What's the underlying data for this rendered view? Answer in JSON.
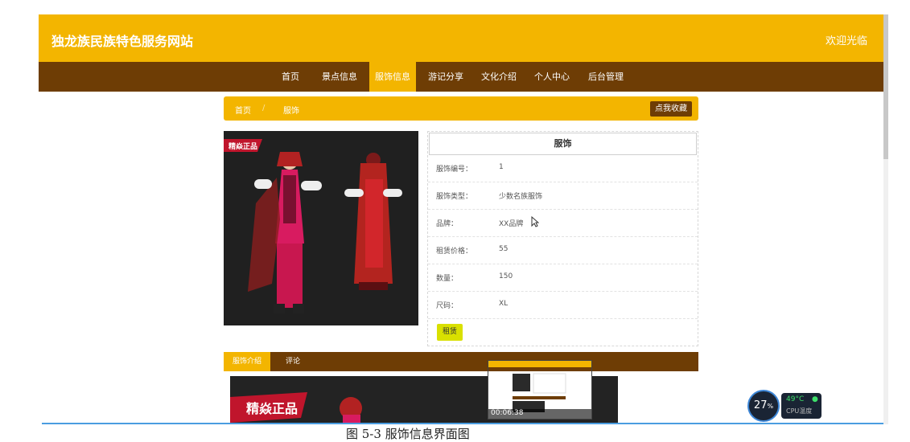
{
  "header": {
    "site_title": "独龙族民族特色服务网站",
    "welcome": "欢迎光临"
  },
  "nav": [
    {
      "label": "首页",
      "active": false
    },
    {
      "label": "景点信息",
      "active": false
    },
    {
      "label": "服饰信息",
      "active": true
    },
    {
      "label": "游记分享",
      "active": false
    },
    {
      "label": "文化介绍",
      "active": false
    },
    {
      "label": "个人中心",
      "active": false
    },
    {
      "label": "后台管理",
      "active": false
    }
  ],
  "breadcrumb": {
    "home": "首页",
    "separator": "/",
    "current": "服饰",
    "favorite_button": "点我收藏"
  },
  "product": {
    "image_badge": "精焱正品",
    "title": "服饰",
    "fields": [
      {
        "label": "服饰编号：",
        "value": "1"
      },
      {
        "label": "服饰类型：",
        "value": "少数名族服饰"
      },
      {
        "label": "品牌：",
        "value": "XX品牌"
      },
      {
        "label": "租赁价格：",
        "value": "55"
      },
      {
        "label": "数量：",
        "value": "150"
      },
      {
        "label": "尺码：",
        "value": "XL"
      }
    ],
    "rent_button": "租赁"
  },
  "tabs": [
    {
      "label": "服饰介绍",
      "active": true
    },
    {
      "label": "评论",
      "active": false
    }
  ],
  "intro_image_text": "精焱正品",
  "video_preview": {
    "time": "00:06:38"
  },
  "cpu_widget": {
    "percent": "27",
    "percent_unit": "%",
    "temp": "49°C",
    "label": "CPU温度"
  },
  "caption": "图 5-3 服饰信息界面图",
  "colors": {
    "primary": "#f3b500",
    "nav_bg": "#6e3d05",
    "rent_button": "#d9e000"
  }
}
